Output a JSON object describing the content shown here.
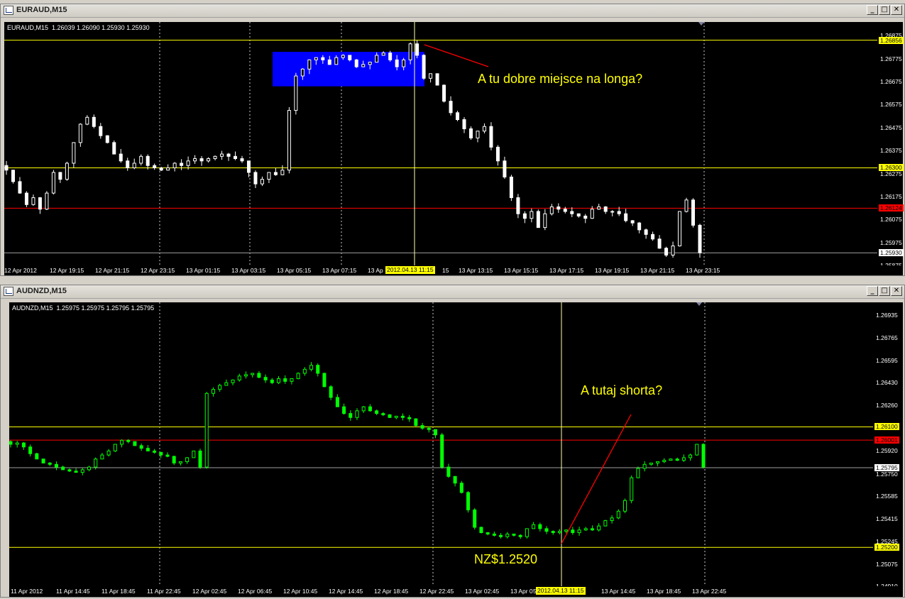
{
  "top_window": {
    "title": "EURAUD,M15",
    "info": "EURAUD,M15  1.26039 1.26090 1.25930 1.25930",
    "price_labels": [
      "1.26875",
      "1.26775",
      "1.26675",
      "1.26575",
      "1.26475",
      "1.26375",
      "1.26275",
      "1.26175",
      "1.26075",
      "1.25975",
      "1.25875"
    ],
    "tags": {
      "hline_top": "1.26856",
      "hline_mid": "1.26300",
      "red_line": "1.26124",
      "last_price": "1.25930"
    },
    "time_labels": [
      "12 Apr 2012",
      "12 Apr 19:15",
      "12 Apr 21:15",
      "12 Apr 23:15",
      "13 Apr 01:15",
      "13 Apr 03:15",
      "13 Apr 05:15",
      "13 Apr 07:15",
      "13 Ap",
      "15",
      "13 Apr 13:15",
      "13 Apr 15:15",
      "13 Apr 17:15",
      "13 Apr 19:15",
      "13 Apr 21:15",
      "13 Apr 23:15"
    ],
    "crosshair_time": "2012.04.13 11:15",
    "annotation": "A tu dobre miejsce na longa?",
    "colors": {
      "candle": "#ffffff",
      "highlight": "#0000ff",
      "hline": "#ffff00",
      "red_line": "#ff0000",
      "arrow": "#ff0000"
    }
  },
  "bottom_window": {
    "title": "AUDNZD,M15",
    "info": "AUDNZD,M15  1.25975 1.25975 1.25795 1.25795",
    "price_labels": [
      "1.26935",
      "1.26765",
      "1.26595",
      "1.26430",
      "1.26260",
      "1.25920",
      "1.25750",
      "1.25585",
      "1.25415",
      "1.25245",
      "1.25075",
      "1.24910"
    ],
    "tags": {
      "hline_top": "1.26100",
      "red_line": "1.26001",
      "last_price": "1.25795",
      "hline_bottom": "1.25200"
    },
    "time_labels": [
      "11 Apr 2012",
      "11 Apr 14:45",
      "11 Apr 18:45",
      "11 Apr 22:45",
      "12 Apr 02:45",
      "12 Apr 06:45",
      "12 Apr 10:45",
      "12 Apr 14:45",
      "12 Apr 18:45",
      "12 Apr 22:45",
      "13 Apr 02:45",
      "13 Apr 0",
      "5",
      "13 Apr 14:45",
      "13 Apr 18:45",
      "13 Apr 22:45"
    ],
    "crosshair_time": "2012.04.13 11:15",
    "annotation_short": "A tutaj shorta?",
    "annotation_price": "NZ$1.2520",
    "colors": {
      "candle": "#00ff00",
      "hline": "#ffff00",
      "red_line": "#ff0000",
      "arrow": "#ff0000"
    }
  },
  "window_controls": {
    "minimize": "_",
    "maximize": "□",
    "close": "✕"
  },
  "chart_data": [
    {
      "type": "candlestick",
      "title": "EURAUD,M15",
      "ylim": [
        1.25875,
        1.26935
      ],
      "x_range": [
        "12 Apr 2012",
        "13 Apr 23:15"
      ],
      "closes": [
        1.2629,
        1.2624,
        1.2619,
        1.2614,
        1.2617,
        1.2612,
        1.2619,
        1.2628,
        1.2625,
        1.2632,
        1.2641,
        1.2649,
        1.2652,
        1.2648,
        1.2644,
        1.2641,
        1.2636,
        1.2633,
        1.263,
        1.2632,
        1.2635,
        1.2631,
        1.263,
        1.2629,
        1.263,
        1.2632,
        1.2631,
        1.2633,
        1.2634,
        1.2633,
        1.2634,
        1.2635,
        1.2636,
        1.2635,
        1.2634,
        1.2633,
        1.2628,
        1.2623,
        1.2625,
        1.2628,
        1.2627,
        1.2629,
        1.2655,
        1.267,
        1.2673,
        1.2677,
        1.2678,
        1.2677,
        1.2675,
        1.2678,
        1.2679,
        1.2677,
        1.2674,
        1.2675,
        1.2676,
        1.2679,
        1.268,
        1.2677,
        1.2674,
        1.2677,
        1.2684,
        1.2679,
        1.2669,
        1.2671,
        1.2666,
        1.2659,
        1.2654,
        1.2651,
        1.2647,
        1.2643,
        1.2646,
        1.2648,
        1.2639,
        1.2633,
        1.2626,
        1.2617,
        1.261,
        1.2608,
        1.2611,
        1.2604,
        1.261,
        1.2613,
        1.2612,
        1.2611,
        1.261,
        1.2609,
        1.2608,
        1.2612,
        1.2613,
        1.2611,
        1.2611,
        1.261,
        1.2607,
        1.2606,
        1.2603,
        1.2601,
        1.2599,
        1.2595,
        1.2592,
        1.2596,
        1.2611,
        1.2616,
        1.2605,
        1.2593
      ]
    },
    {
      "type": "candlestick",
      "title": "AUDNZD,M15",
      "ylim": [
        1.2491,
        1.2703
      ],
      "x_range": [
        "11 Apr 2012",
        "13 Apr 22:45"
      ],
      "closes": [
        1.2597,
        1.2598,
        1.2595,
        1.259,
        1.2586,
        1.2583,
        1.2582,
        1.258,
        1.2578,
        1.2577,
        1.2576,
        1.2578,
        1.258,
        1.2586,
        1.2589,
        1.2592,
        1.2597,
        1.26,
        1.2599,
        1.2596,
        1.2594,
        1.2592,
        1.2591,
        1.2589,
        1.2588,
        1.2583,
        1.2584,
        1.2587,
        1.2592,
        1.258,
        1.2635,
        1.2638,
        1.2641,
        1.2643,
        1.2645,
        1.2648,
        1.2649,
        1.265,
        1.2647,
        1.2645,
        1.2643,
        1.2646,
        1.2644,
        1.2646,
        1.265,
        1.2653,
        1.2656,
        1.265,
        1.264,
        1.2632,
        1.2625,
        1.262,
        1.2617,
        1.2622,
        1.2625,
        1.2622,
        1.262,
        1.2619,
        1.2617,
        1.2618,
        1.2617,
        1.2616,
        1.2611,
        1.2609,
        1.2608,
        1.2604,
        1.258,
        1.2573,
        1.2568,
        1.2561,
        1.2548,
        1.2535,
        1.2531,
        1.253,
        1.2529,
        1.2528,
        1.253,
        1.2529,
        1.2528,
        1.2534,
        1.2537,
        1.2534,
        1.2532,
        1.2531,
        1.2532,
        1.2533,
        1.2531,
        1.2533,
        1.2534,
        1.2533,
        1.2536,
        1.254,
        1.2542,
        1.2547,
        1.2555,
        1.2572,
        1.2579,
        1.2582,
        1.2583,
        1.2584,
        1.2585,
        1.2586,
        1.2585,
        1.2587,
        1.2589,
        1.2597,
        1.258
      ]
    }
  ]
}
